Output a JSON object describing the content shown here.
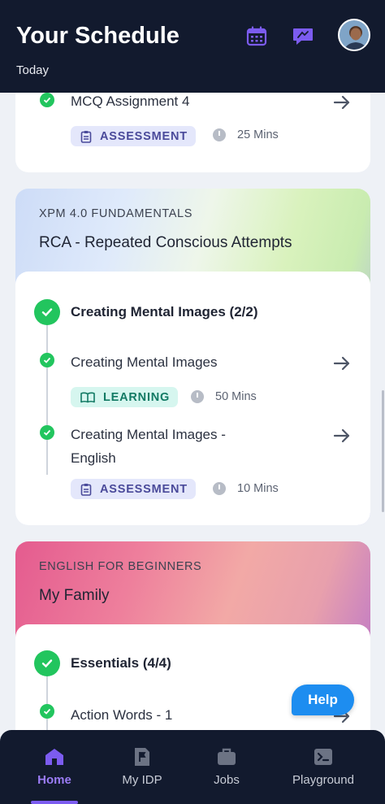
{
  "header": {
    "title": "Your Schedule",
    "subtitle": "Today",
    "calendar_icon": "calendar-icon",
    "chat_icon": "chat-icon",
    "avatar_alt": "avatar"
  },
  "first_card": {
    "item_title": "MCQ Assignment 4",
    "badge": "ASSESSMENT",
    "duration": "25 Mins"
  },
  "courses": [
    {
      "kicker": "XPM 4.0 FUNDAMENTALS",
      "name": "RCA - Repeated Conscious Attempts",
      "group_title": "Creating Mental Images (2/2)",
      "items": [
        {
          "title": "Creating Mental Images",
          "badge": "LEARNING",
          "duration": "50 Mins"
        },
        {
          "title_line1": "Creating Mental Images -",
          "title_line2": "English",
          "badge": "ASSESSMENT",
          "duration": "10 Mins"
        }
      ]
    },
    {
      "kicker": "ENGLISH FOR BEGINNERS",
      "name": "My Family",
      "group_title": "Essentials (4/4)",
      "items": [
        {
          "title": "Action Words - 1"
        }
      ]
    }
  ],
  "help_label": "Help",
  "nav": {
    "items": [
      {
        "label": "Home",
        "icon": "home-icon"
      },
      {
        "label": "My IDP",
        "icon": "flag-document-icon"
      },
      {
        "label": "Jobs",
        "icon": "briefcase-icon"
      },
      {
        "label": "Playground",
        "icon": "terminal-icon"
      }
    ],
    "active": "Home"
  },
  "colors": {
    "header_bg": "#121a2e",
    "accent_purple": "#7c5cf0",
    "check_green": "#22c55e",
    "help_blue": "#1d8df0"
  }
}
